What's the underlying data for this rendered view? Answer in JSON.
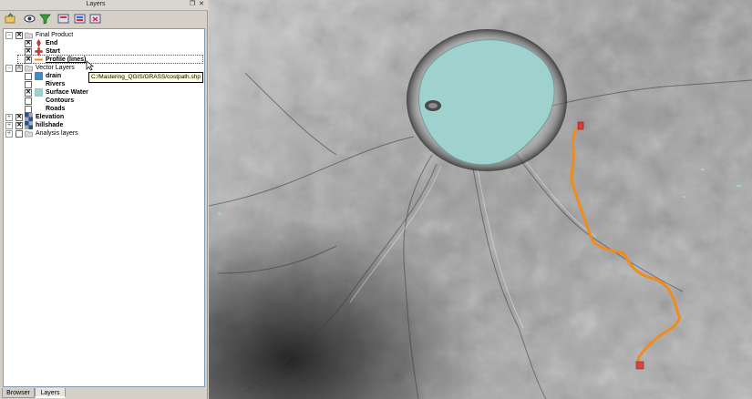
{
  "dock": {
    "title": "Layers",
    "float_icon": "undock-icon",
    "close_icon": "close-icon",
    "toolbar": [
      "open-layer-icon",
      "show-layer-icon",
      "filter-legend-icon",
      "add-group-icon",
      "expand-all-icon",
      "remove-layer-icon"
    ]
  },
  "tree": {
    "rows": [
      {
        "label": "Final Product",
        "expander": "-",
        "checked": true,
        "icon": "folder-icon",
        "bold": false
      },
      {
        "label": "End",
        "checked": true,
        "icon": "red-pin-icon",
        "bold": true
      },
      {
        "label": "Start",
        "checked": true,
        "icon": "red-cross-icon",
        "bold": true
      },
      {
        "label": "Profile (lines)",
        "checked": true,
        "icon": "orange-line-icon",
        "bold": true
      },
      {
        "label": "Vector Layers",
        "expander": "-",
        "checked": true,
        "icon": "folder-icon",
        "bold": false
      },
      {
        "label": "drain",
        "checked": false,
        "icon": "blue-polygon-icon",
        "bold": true
      },
      {
        "label": "Rivers",
        "checked": false,
        "icon": "line-icon",
        "bold": true
      },
      {
        "label": "Surface Water",
        "checked": true,
        "icon": "lightblue-polygon-icon",
        "bold": true
      },
      {
        "label": "Contours",
        "checked": false,
        "icon": "line-icon",
        "bold": true
      },
      {
        "label": "Roads",
        "checked": false,
        "icon": "line-icon",
        "bold": true
      },
      {
        "label": "Elevation",
        "expander": "+",
        "checked": true,
        "icon": "raster-icon",
        "bold": true
      },
      {
        "label": "hillshade",
        "expander": "+",
        "checked": true,
        "icon": "raster-icon",
        "bold": true
      },
      {
        "label": "Analysis layers",
        "expander": "+",
        "checked": false,
        "icon": "folder-icon",
        "bold": false
      }
    ],
    "tooltip": "C:/Mastering_QGIS/GRASS/costpath.shp"
  },
  "tabs": [
    {
      "label": "Browser",
      "active": false
    },
    {
      "label": "Layers",
      "active": true
    }
  ],
  "map": {
    "lake_color": "#9fd1cf",
    "path_color": "#f08c1e",
    "marker_color": "#d83a3a"
  }
}
